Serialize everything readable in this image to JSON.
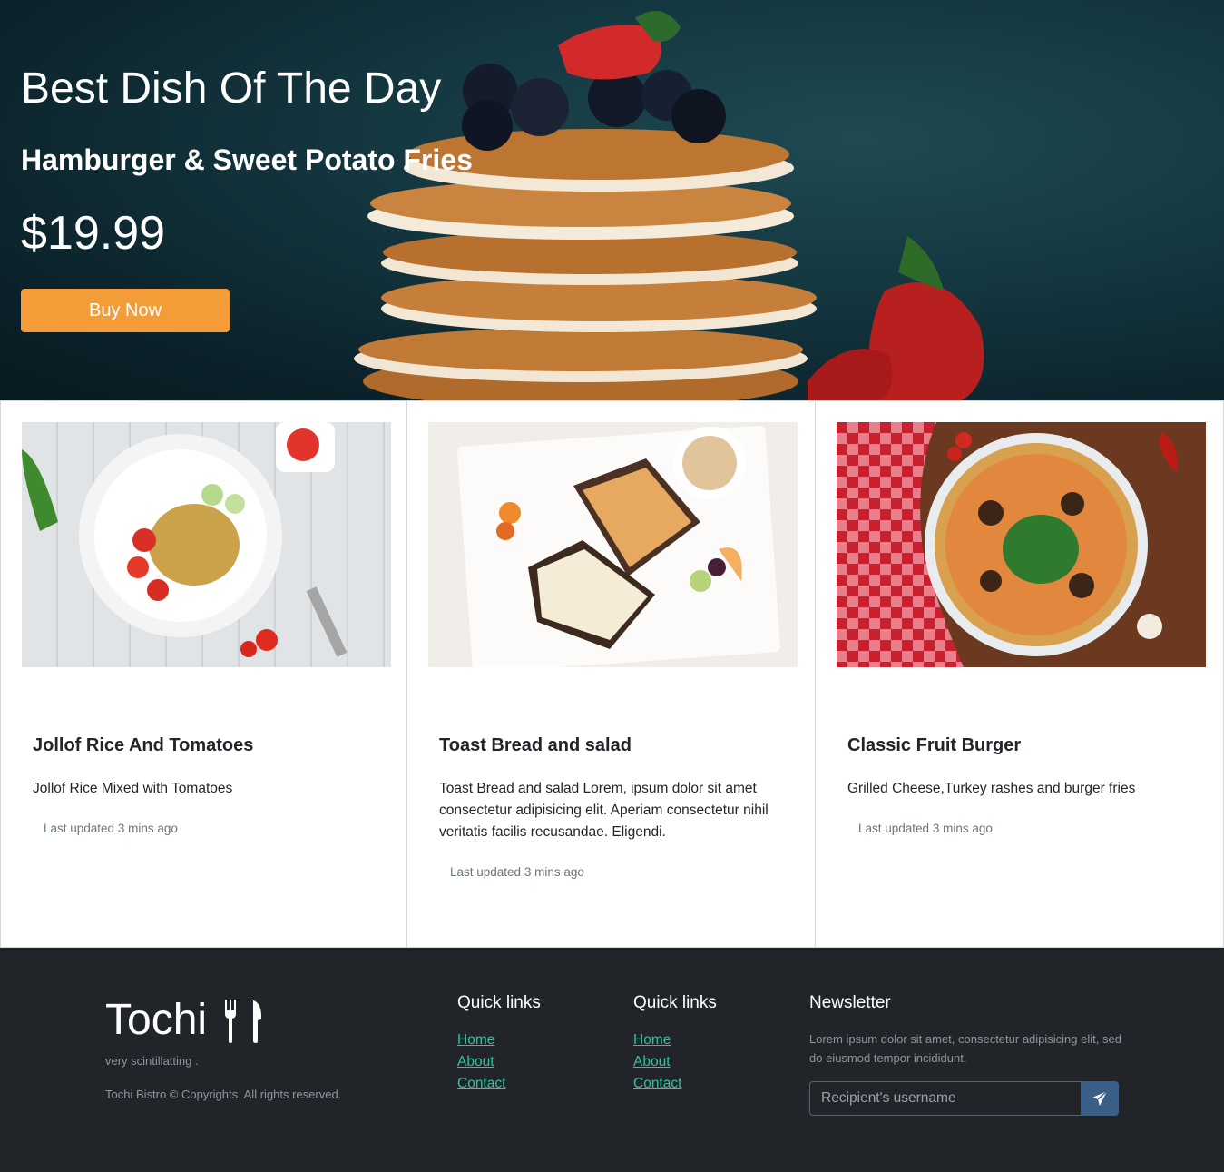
{
  "hero": {
    "title": "Best Dish Of The Day",
    "subtitle": "Hamburger & Sweet Potato Fries",
    "price": "$19.99",
    "button_label": "Buy Now"
  },
  "cards": [
    {
      "title": "Jollof Rice And Tomatoes",
      "text": "Jollof Rice Mixed with Tomatoes",
      "meta": "Last updated 3 mins ago"
    },
    {
      "title": "Toast Bread and salad",
      "text": "Toast Bread and salad Lorem, ipsum dolor sit amet consectetur adipisicing elit. Aperiam consectetur nihil veritatis facilis recusandae. Eligendi.",
      "meta": "Last updated 3 mins ago"
    },
    {
      "title": "Classic Fruit Burger",
      "text": "Grilled Cheese,Turkey rashes and burger fries",
      "meta": "Last updated 3 mins ago"
    }
  ],
  "footer": {
    "brand": "Tochi",
    "tagline": "very scintillatting .",
    "copyright": "Tochi Bistro © Copyrights. All rights reserved.",
    "links_1": {
      "title": "Quick links",
      "items": [
        "Home",
        "About",
        "Contact"
      ]
    },
    "links_2": {
      "title": "Quick links",
      "items": [
        "Home",
        "About",
        "Contact"
      ]
    },
    "newsletter": {
      "title": "Newsletter",
      "text": "Lorem ipsum dolor sit amet, consectetur adipisicing elit, sed do eiusmod tempor incididunt.",
      "placeholder": "Recipient's username"
    }
  },
  "colors": {
    "accent": "#f39c38",
    "link": "#35c0a0",
    "footer_bg": "#212529",
    "send_button": "#3a5f87"
  }
}
